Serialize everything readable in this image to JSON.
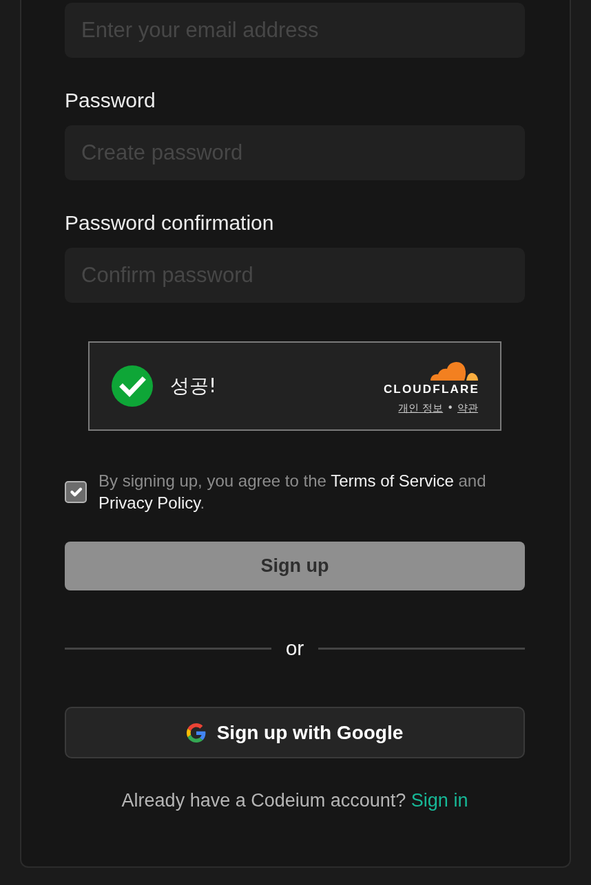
{
  "fields": [
    {
      "placeholder": "Enter your email address"
    },
    {
      "label": "Password",
      "placeholder": "Create password"
    },
    {
      "label": "Password confirmation",
      "placeholder": "Confirm password"
    }
  ],
  "captcha": {
    "verified": true,
    "status_text": "성공!",
    "brand": "CLOUDFLARE",
    "links": [
      "개인 정보",
      "약관"
    ],
    "separator": "•"
  },
  "terms": {
    "checked": true,
    "parts": [
      {
        "kind": "text",
        "text": "By signing up, you agree to the "
      },
      {
        "kind": "link",
        "text": "Terms of Service"
      },
      {
        "kind": "text",
        "text": " and "
      },
      {
        "kind": "link",
        "text": "Privacy Policy"
      },
      {
        "kind": "text",
        "text": "."
      }
    ]
  },
  "signup_button": "Sign up",
  "divider": "or",
  "google_button": "Sign up with Google",
  "signin_prompt": {
    "text": "Already have a Codeium account?",
    "link": "Sign in"
  }
}
